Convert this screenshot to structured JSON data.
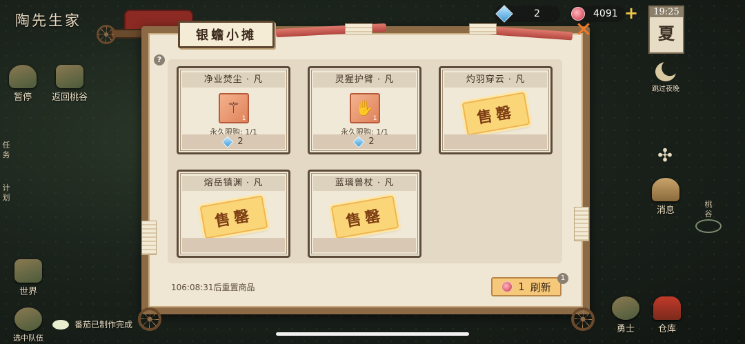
{
  "game_title": "陶先生家",
  "left_menu": {
    "pause": "暂停",
    "return": "返回桃谷",
    "tasks": "任务",
    "plan": "计划",
    "world": "世界",
    "team": "选中队伍"
  },
  "notification": "番茄已制作完成",
  "resources": {
    "gems": "2",
    "flowers": "4091",
    "add": "+"
  },
  "clock": {
    "time": "19:25",
    "season": "夏"
  },
  "right_menu": {
    "skip_night": "跳过夜晚",
    "messages": "消息",
    "peach_valley": "桃谷",
    "warrior": "勇士",
    "warehouse": "仓库"
  },
  "shop": {
    "title": "银蟾小摊",
    "help": "?",
    "close": "✕",
    "items": [
      {
        "name": "净业焚尘 · 凡",
        "glyph": "⚚",
        "qty": "1",
        "limit": "永久限购: 1/1",
        "cost": "2",
        "sold_out": false
      },
      {
        "name": "灵猩护臂 · 凡",
        "glyph": "✋",
        "qty": "1",
        "limit": "永久限购: 1/1",
        "cost": "2",
        "sold_out": false
      },
      {
        "name": "灼羽穿云 · 凡",
        "sold_label": "售罄",
        "sold_out": true
      },
      {
        "name": "熔岳镇渊 · 凡",
        "sold_label": "售罄",
        "sold_out": true
      },
      {
        "name": "蓝璃兽杖 · 凡",
        "sold_label": "售罄",
        "sold_out": true
      }
    ],
    "reset_timer": "106:08:31后重置商品",
    "refresh": {
      "cost": "1",
      "label": "刷新",
      "badge": "1"
    }
  }
}
